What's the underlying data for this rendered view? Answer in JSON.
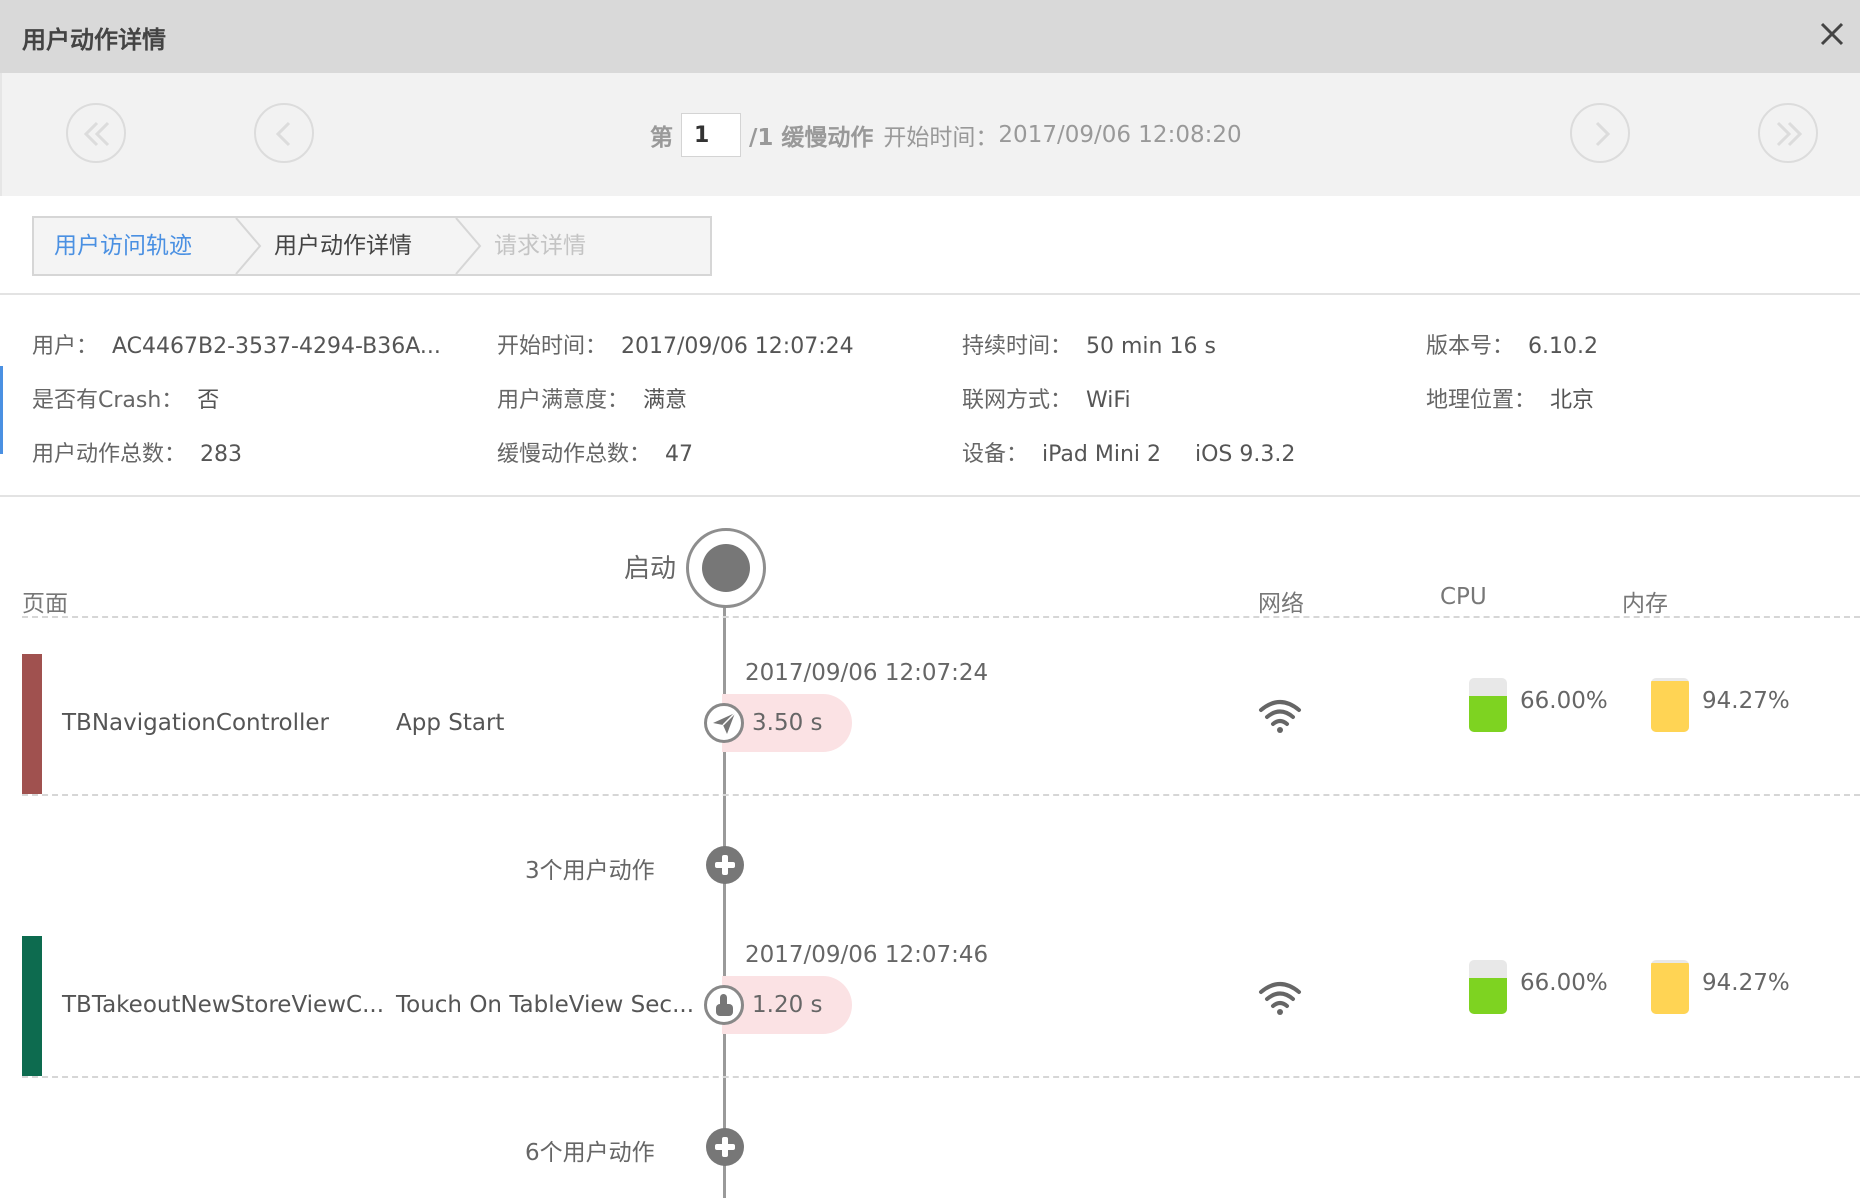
{
  "window": {
    "title": "用户动作详情",
    "close_icon": "close-icon"
  },
  "pager": {
    "prefix": "第",
    "page_value": "1",
    "suffix": "/1 缓慢动作",
    "start_label": "开始时间：",
    "start_time": "2017/09/06 12:08:20"
  },
  "breadcrumb": [
    {
      "label": "用户访问轨迹",
      "color": "#4a90e2"
    },
    {
      "label": "用户动作详情",
      "color": "#444444"
    },
    {
      "label": "请求详情",
      "color": "#c4c4c4"
    }
  ],
  "info": {
    "user_label": "用户：",
    "user_value": "AC4467B2-3537-4294-B36A...",
    "start_label": "开始时间：",
    "start_value": "2017/09/06 12:07:24",
    "duration_label": "持续时间：",
    "duration_value": "50 min 16 s",
    "version_label": "版本号：",
    "version_value": "6.10.2",
    "crash_label": "是否有Crash：",
    "crash_value": "否",
    "satisfaction_label": "用户满意度：",
    "satisfaction_value": "满意",
    "network_label": "联网方式：",
    "network_value": "WiFi",
    "location_label": "地理位置：",
    "location_value": "北京",
    "actions_label": "用户动作总数：",
    "actions_value": "283",
    "slow_label": "缓慢动作总数：",
    "slow_value": "47",
    "device_label": "设备：",
    "device_value": "iPad Mini 2",
    "os_value": "iOS 9.3.2"
  },
  "timeline": {
    "columns": {
      "page": "页面",
      "network": "网络",
      "cpu": "CPU",
      "memory": "内存"
    },
    "start_label": "启动",
    "rows": [
      {
        "color": "#a0514f",
        "page": "TBNavigationController",
        "action": "App Start",
        "time": "2017/09/06 12:07:24",
        "duration": "3.50 s",
        "icon": "paper-plane-icon",
        "cpu": "66.00%",
        "cpu_level": 0.66,
        "memory": "94.27%",
        "memory_level": 0.9427
      },
      {
        "color": "#0d6b4f",
        "page": "TBTakeoutNewStoreViewC...",
        "action": "Touch On TableView Sec...",
        "time": "2017/09/06 12:07:46",
        "duration": "1.20 s",
        "icon": "tap-hand-icon",
        "cpu": "66.00%",
        "cpu_level": 0.66,
        "memory": "94.27%",
        "memory_level": 0.9427
      }
    ],
    "groups": [
      {
        "label": "3个用户动作"
      },
      {
        "label": "6个用户动作"
      }
    ]
  }
}
